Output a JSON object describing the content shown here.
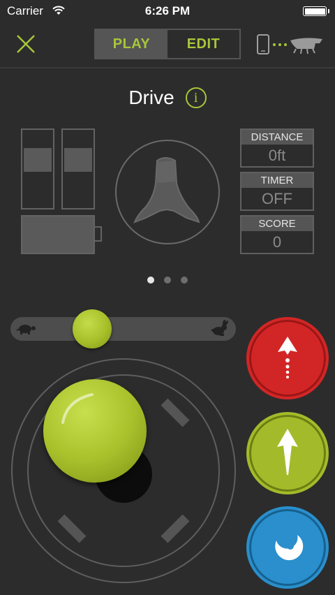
{
  "status_bar": {
    "carrier": "Carrier",
    "time": "6:26 PM"
  },
  "header": {
    "tabs": [
      {
        "label": "PLAY",
        "active": true
      },
      {
        "label": "EDIT",
        "active": false
      }
    ],
    "accent_color": "#a8c63a"
  },
  "page": {
    "title": "Drive",
    "info_glyph": "i"
  },
  "motors": {
    "left_level": 0.3,
    "right_level": 0.3
  },
  "battery_level": 1.0,
  "stats": [
    {
      "label": "DISTANCE",
      "value": "0ft"
    },
    {
      "label": "TIMER",
      "value": "OFF"
    },
    {
      "label": "SCORE",
      "value": "0"
    }
  ],
  "pager": {
    "pages": 3,
    "current": 1
  },
  "speed_slider": {
    "min_icon": "turtle-icon",
    "max_icon": "rabbit-icon",
    "value": 0.33
  },
  "joystick": {
    "x": -0.27,
    "y": 0.41
  },
  "actions": [
    {
      "name": "boost-button",
      "icon": "dotted-arrow-up-icon",
      "color": "#d22626"
    },
    {
      "name": "forward-button",
      "icon": "arrow-up-icon",
      "color": "#a3bb2a"
    },
    {
      "name": "special-button",
      "icon": "swirl-icon",
      "color": "#2a8fcc"
    }
  ]
}
